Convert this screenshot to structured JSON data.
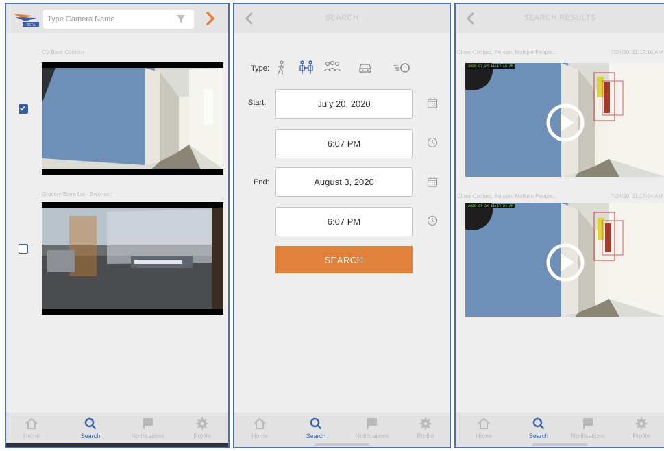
{
  "camera_list": {
    "search_placeholder": "Type Camera Name",
    "cameras": [
      {
        "name": "CV Back Corridor",
        "checked": true
      },
      {
        "name": "Grocery Store Lot - Swenson",
        "checked": false
      }
    ]
  },
  "search_form": {
    "title": "SEARCH",
    "type_label": "Type:",
    "type_icons": [
      "walking-person-icon",
      "close-contact-icon",
      "group-people-icon",
      "vehicle-icon",
      "speed-icon"
    ],
    "start_label": "Start:",
    "start_date": "July 20, 2020",
    "start_time": "6:07 PM",
    "end_label": "End:",
    "end_date": "August 3, 2020",
    "end_time": "6:07 PM",
    "search_button": "SEARCH"
  },
  "results": {
    "title": "SEARCH RESULTS",
    "items": [
      {
        "description": "Close Contact, Person, Multiple People...",
        "timestamp": "7/24/20, 11:17:16 AM",
        "overlay": "2020-07-24 11:17:16 AM"
      },
      {
        "description": "Close Contact, Person, Multiple People...",
        "timestamp": "7/24/20, 11:17:04 AM",
        "overlay": "2020-07-24 11:17:04 AM"
      }
    ]
  },
  "nav": {
    "home": "Home",
    "search": "Search",
    "notifications": "Notifications",
    "profile": "Profile",
    "active": "search"
  },
  "colors": {
    "accent_orange": "#e2813b",
    "accent_blue": "#3b5ea8",
    "panel_border": "#4a6fb4"
  }
}
